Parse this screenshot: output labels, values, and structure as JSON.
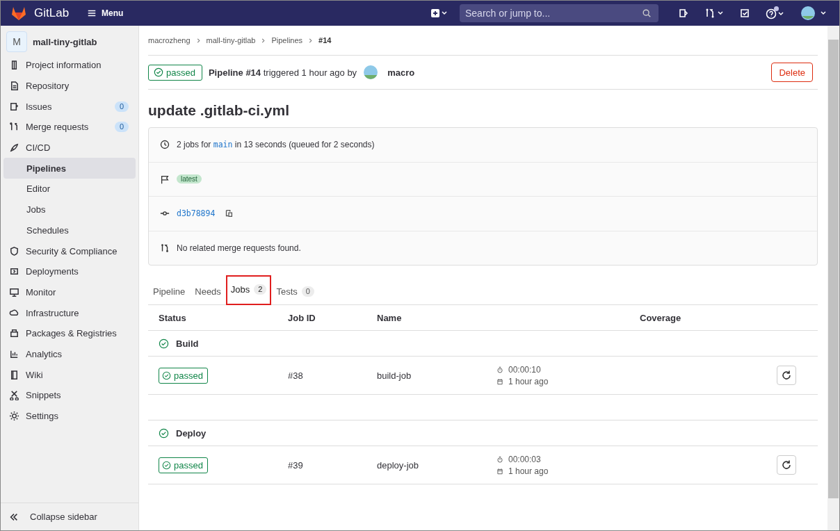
{
  "topbar": {
    "brand": "GitLab",
    "menu": "Menu",
    "search": {
      "placeholder": "Search or jump to..."
    },
    "help_notification": true
  },
  "sidebar": {
    "project": {
      "avatar": "M",
      "name": "mall-tiny-gitlab"
    },
    "items": [
      {
        "label": "Project information",
        "selected": false
      },
      {
        "label": "Repository",
        "selected": false
      },
      {
        "label": "Issues",
        "count": "0",
        "selected": false
      },
      {
        "label": "Merge requests",
        "count": "0",
        "selected": false
      },
      {
        "label": "CI/CD",
        "selected": false,
        "children": [
          {
            "label": "Pipelines",
            "selected": true
          },
          {
            "label": "Editor",
            "selected": false
          },
          {
            "label": "Jobs",
            "selected": false
          },
          {
            "label": "Schedules",
            "selected": false
          }
        ]
      },
      {
        "label": "Security & Compliance",
        "selected": false
      },
      {
        "label": "Deployments",
        "selected": false
      },
      {
        "label": "Monitor",
        "selected": false
      },
      {
        "label": "Infrastructure",
        "selected": false
      },
      {
        "label": "Packages & Registries",
        "selected": false
      },
      {
        "label": "Analytics",
        "selected": false
      },
      {
        "label": "Wiki",
        "selected": false
      },
      {
        "label": "Snippets",
        "selected": false
      },
      {
        "label": "Settings",
        "selected": false
      }
    ],
    "collapse": "Collapse sidebar"
  },
  "breadcrumbs": [
    "macrozheng",
    "mall-tiny-gitlab",
    "Pipelines",
    "#14"
  ],
  "pipeline_header": {
    "status": "passed",
    "text": "**Pipeline #14** triggered 1 hour ago by",
    "user": "macro",
    "delete": "Delete"
  },
  "title": "update .gitlab-ci.yml",
  "info": {
    "jobs_prefix": "2 jobs for",
    "branch": "main",
    "jobs_suffix": "in 13 seconds (queued for 2 seconds)",
    "tag": "latest",
    "commit": "d3b78894",
    "merge_requests": "No related merge requests found."
  },
  "tabs": [
    {
      "label": "Pipeline",
      "selected": false,
      "highlighted": false
    },
    {
      "label": "Needs",
      "selected": false,
      "highlighted": false
    },
    {
      "label": "Jobs",
      "count": "2",
      "selected": true,
      "highlighted": true
    },
    {
      "label": "Tests",
      "count": "0",
      "selected": false,
      "highlighted": false
    }
  ],
  "table": {
    "columns": [
      "Status",
      "Job ID",
      "Name",
      "",
      "Coverage"
    ],
    "stages": [
      {
        "name": "Build",
        "jobs": [
          {
            "status": "passed",
            "id": "#38",
            "name": "build-job",
            "duration": "00:00:10",
            "finished": "1 hour ago"
          }
        ]
      },
      {
        "name": "Deploy",
        "jobs": [
          {
            "status": "passed",
            "id": "#39",
            "name": "deploy-job",
            "duration": "00:00:03",
            "finished": "1 hour ago"
          }
        ]
      }
    ]
  }
}
